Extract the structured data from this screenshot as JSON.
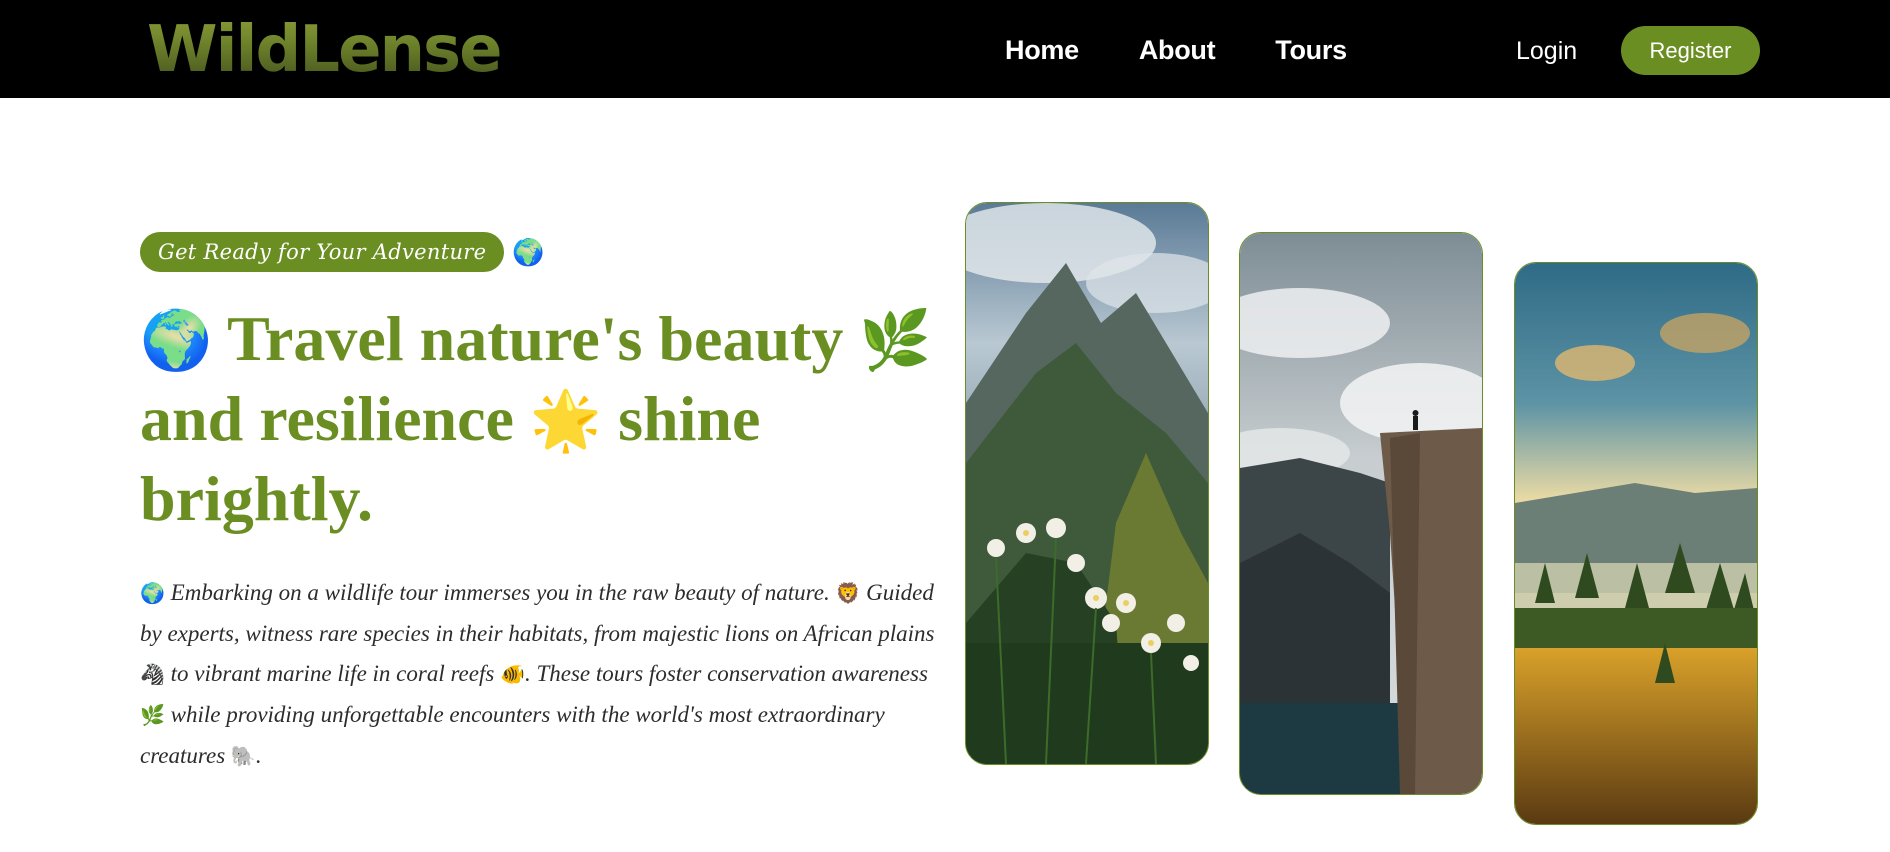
{
  "nav": {
    "logo_text": "WildLense",
    "links": [
      "Home",
      "About",
      "Tours"
    ],
    "login_label": "Login",
    "register_label": "Register"
  },
  "hero": {
    "badge_text": "Get Ready for Your Adventure",
    "badge_emoji": "🌍",
    "headline": {
      "emoji_1": "🌍",
      "part_1": "Travel nature's beauty",
      "emoji_2": "🌿",
      "part_2": "and resilience",
      "emoji_3": "🌟",
      "part_3": "shine brightly."
    },
    "paragraph": {
      "emoji_globe": "🌍",
      "text_1": "Embarking on a wildlife tour immerses you in the raw beauty of nature.",
      "emoji_lion": "🦁",
      "text_2": "Guided by experts, witness rare species in their habitats, from majestic lions on African plains",
      "emoji_zebra": "🦓",
      "text_3": "to vibrant marine life in coral reefs",
      "emoji_fish": "🐠",
      "text_4": ". These tours foster conservation awareness",
      "emoji_herb": "🌿",
      "text_5": "while providing unforgettable encounters with the world's most extraordinary creatures",
      "emoji_elephant": "🐘",
      "text_6": "."
    }
  },
  "gallery": {
    "cards": [
      {
        "subject": "mountain ridge with alpine flowers"
      },
      {
        "subject": "person on cliff edge above fjord"
      },
      {
        "subject": "misty forest valley at sunset"
      }
    ]
  },
  "colors": {
    "brand_green": "#6b8e23",
    "navbar_bg": "#000000"
  }
}
